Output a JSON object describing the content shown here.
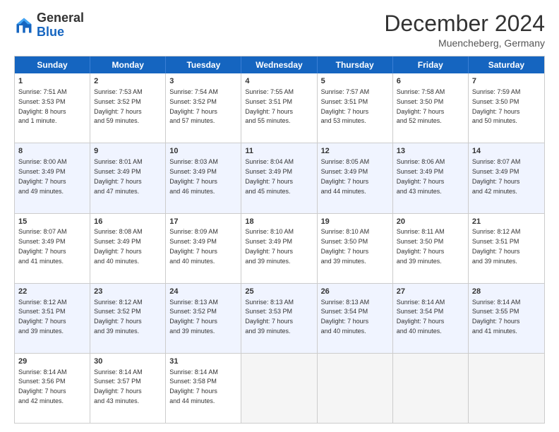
{
  "logo": {
    "general": "General",
    "blue": "Blue"
  },
  "title": "December 2024",
  "subtitle": "Muencheberg, Germany",
  "days": [
    "Sunday",
    "Monday",
    "Tuesday",
    "Wednesday",
    "Thursday",
    "Friday",
    "Saturday"
  ],
  "weeks": [
    [
      {
        "day": "1",
        "sunrise": "Sunrise: 7:51 AM",
        "sunset": "Sunset: 3:53 PM",
        "daylight": "Daylight: 8 hours and 1 minute."
      },
      {
        "day": "2",
        "sunrise": "Sunrise: 7:53 AM",
        "sunset": "Sunset: 3:52 PM",
        "daylight": "Daylight: 7 hours and 59 minutes."
      },
      {
        "day": "3",
        "sunrise": "Sunrise: 7:54 AM",
        "sunset": "Sunset: 3:52 PM",
        "daylight": "Daylight: 7 hours and 57 minutes."
      },
      {
        "day": "4",
        "sunrise": "Sunrise: 7:55 AM",
        "sunset": "Sunset: 3:51 PM",
        "daylight": "Daylight: 7 hours and 55 minutes."
      },
      {
        "day": "5",
        "sunrise": "Sunrise: 7:57 AM",
        "sunset": "Sunset: 3:51 PM",
        "daylight": "Daylight: 7 hours and 53 minutes."
      },
      {
        "day": "6",
        "sunrise": "Sunrise: 7:58 AM",
        "sunset": "Sunset: 3:50 PM",
        "daylight": "Daylight: 7 hours and 52 minutes."
      },
      {
        "day": "7",
        "sunrise": "Sunrise: 7:59 AM",
        "sunset": "Sunset: 3:50 PM",
        "daylight": "Daylight: 7 hours and 50 minutes."
      }
    ],
    [
      {
        "day": "8",
        "sunrise": "Sunrise: 8:00 AM",
        "sunset": "Sunset: 3:49 PM",
        "daylight": "Daylight: 7 hours and 49 minutes."
      },
      {
        "day": "9",
        "sunrise": "Sunrise: 8:01 AM",
        "sunset": "Sunset: 3:49 PM",
        "daylight": "Daylight: 7 hours and 47 minutes."
      },
      {
        "day": "10",
        "sunrise": "Sunrise: 8:03 AM",
        "sunset": "Sunset: 3:49 PM",
        "daylight": "Daylight: 7 hours and 46 minutes."
      },
      {
        "day": "11",
        "sunrise": "Sunrise: 8:04 AM",
        "sunset": "Sunset: 3:49 PM",
        "daylight": "Daylight: 7 hours and 45 minutes."
      },
      {
        "day": "12",
        "sunrise": "Sunrise: 8:05 AM",
        "sunset": "Sunset: 3:49 PM",
        "daylight": "Daylight: 7 hours and 44 minutes."
      },
      {
        "day": "13",
        "sunrise": "Sunrise: 8:06 AM",
        "sunset": "Sunset: 3:49 PM",
        "daylight": "Daylight: 7 hours and 43 minutes."
      },
      {
        "day": "14",
        "sunrise": "Sunrise: 8:07 AM",
        "sunset": "Sunset: 3:49 PM",
        "daylight": "Daylight: 7 hours and 42 minutes."
      }
    ],
    [
      {
        "day": "15",
        "sunrise": "Sunrise: 8:07 AM",
        "sunset": "Sunset: 3:49 PM",
        "daylight": "Daylight: 7 hours and 41 minutes."
      },
      {
        "day": "16",
        "sunrise": "Sunrise: 8:08 AM",
        "sunset": "Sunset: 3:49 PM",
        "daylight": "Daylight: 7 hours and 40 minutes."
      },
      {
        "day": "17",
        "sunrise": "Sunrise: 8:09 AM",
        "sunset": "Sunset: 3:49 PM",
        "daylight": "Daylight: 7 hours and 40 minutes."
      },
      {
        "day": "18",
        "sunrise": "Sunrise: 8:10 AM",
        "sunset": "Sunset: 3:49 PM",
        "daylight": "Daylight: 7 hours and 39 minutes."
      },
      {
        "day": "19",
        "sunrise": "Sunrise: 8:10 AM",
        "sunset": "Sunset: 3:50 PM",
        "daylight": "Daylight: 7 hours and 39 minutes."
      },
      {
        "day": "20",
        "sunrise": "Sunrise: 8:11 AM",
        "sunset": "Sunset: 3:50 PM",
        "daylight": "Daylight: 7 hours and 39 minutes."
      },
      {
        "day": "21",
        "sunrise": "Sunrise: 8:12 AM",
        "sunset": "Sunset: 3:51 PM",
        "daylight": "Daylight: 7 hours and 39 minutes."
      }
    ],
    [
      {
        "day": "22",
        "sunrise": "Sunrise: 8:12 AM",
        "sunset": "Sunset: 3:51 PM",
        "daylight": "Daylight: 7 hours and 39 minutes."
      },
      {
        "day": "23",
        "sunrise": "Sunrise: 8:12 AM",
        "sunset": "Sunset: 3:52 PM",
        "daylight": "Daylight: 7 hours and 39 minutes."
      },
      {
        "day": "24",
        "sunrise": "Sunrise: 8:13 AM",
        "sunset": "Sunset: 3:52 PM",
        "daylight": "Daylight: 7 hours and 39 minutes."
      },
      {
        "day": "25",
        "sunrise": "Sunrise: 8:13 AM",
        "sunset": "Sunset: 3:53 PM",
        "daylight": "Daylight: 7 hours and 39 minutes."
      },
      {
        "day": "26",
        "sunrise": "Sunrise: 8:13 AM",
        "sunset": "Sunset: 3:54 PM",
        "daylight": "Daylight: 7 hours and 40 minutes."
      },
      {
        "day": "27",
        "sunrise": "Sunrise: 8:14 AM",
        "sunset": "Sunset: 3:54 PM",
        "daylight": "Daylight: 7 hours and 40 minutes."
      },
      {
        "day": "28",
        "sunrise": "Sunrise: 8:14 AM",
        "sunset": "Sunset: 3:55 PM",
        "daylight": "Daylight: 7 hours and 41 minutes."
      }
    ],
    [
      {
        "day": "29",
        "sunrise": "Sunrise: 8:14 AM",
        "sunset": "Sunset: 3:56 PM",
        "daylight": "Daylight: 7 hours and 42 minutes."
      },
      {
        "day": "30",
        "sunrise": "Sunrise: 8:14 AM",
        "sunset": "Sunset: 3:57 PM",
        "daylight": "Daylight: 7 hours and 43 minutes."
      },
      {
        "day": "31",
        "sunrise": "Sunrise: 8:14 AM",
        "sunset": "Sunset: 3:58 PM",
        "daylight": "Daylight: 7 hours and 44 minutes."
      },
      null,
      null,
      null,
      null
    ]
  ]
}
